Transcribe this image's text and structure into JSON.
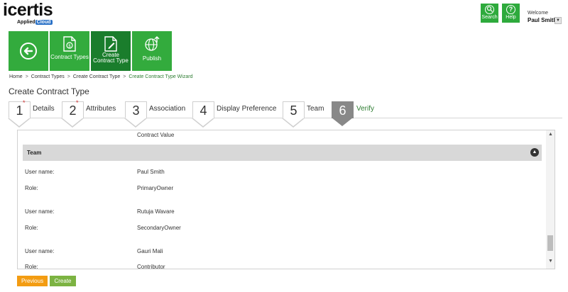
{
  "brand": {
    "logo_text": "icertis",
    "sub_text": "Applied",
    "sub_highlight": "Cloud"
  },
  "header": {
    "search_label": "Search",
    "help_label": "Help",
    "welcome_label": "Welcome",
    "user_name": "Paul Smith"
  },
  "toolbar": {
    "back_icon": "back-arrow-icon",
    "contract_types_label": "Contract Types",
    "create_contract_type_label": "Create Contract Type",
    "publish_label": "Publish"
  },
  "breadcrumb": [
    "Home",
    "Contract Types",
    "Create Contract Type",
    "Create Contract Type Wizard"
  ],
  "page_title": "Create Contract Type",
  "steps": [
    {
      "number": "1",
      "label": "Details",
      "required": true,
      "active": false
    },
    {
      "number": "2",
      "label": "Attributes",
      "required": true,
      "active": false
    },
    {
      "number": "3",
      "label": "Association",
      "required": false,
      "active": false
    },
    {
      "number": "4",
      "label": "Display Preference",
      "required": false,
      "active": false
    },
    {
      "number": "5",
      "label": "Team",
      "required": false,
      "active": false
    },
    {
      "number": "6",
      "label": "Verify",
      "required": false,
      "active": true
    }
  ],
  "required_marker": "*",
  "panel": {
    "contract_value_label": "Contract Value",
    "section_title": "Team",
    "members": [
      {
        "user_label": "User name:",
        "user_value": "Paul Smith",
        "role_label": "Role:",
        "role_value": "PrimaryOwner"
      },
      {
        "user_label": "User name:",
        "user_value": "Rutuja Wavare",
        "role_label": "Role:",
        "role_value": "SecondaryOwner"
      },
      {
        "user_label": "User name:",
        "user_value": "Gauri Mali",
        "role_label": "Role:",
        "role_value": "Contributor"
      }
    ]
  },
  "actions": {
    "previous_label": "Previous",
    "create_label": "Create"
  },
  "colors": {
    "brand_green": "#33ab3d",
    "dark_green": "#1a7d2c",
    "previous_orange": "#f39c12",
    "create_green": "#7cb342"
  }
}
